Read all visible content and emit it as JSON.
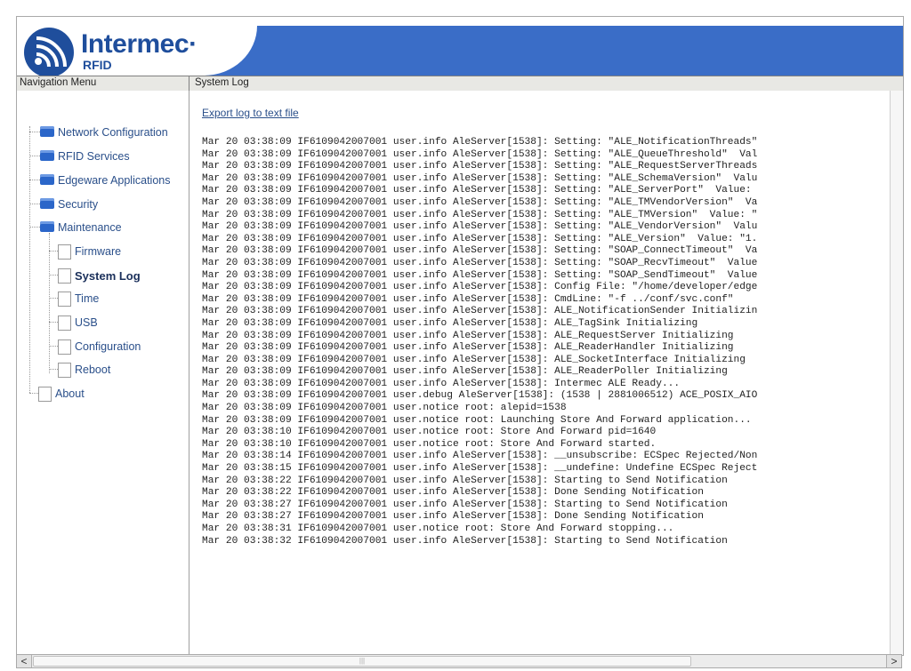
{
  "brand": {
    "name": "Intermec",
    "suffix": "RFID",
    "registered": "·"
  },
  "bars": {
    "nav_title": "Navigation Menu",
    "content_title": "System Log"
  },
  "nav": {
    "items": [
      {
        "label": "Network Configuration",
        "icon": "folder-icon"
      },
      {
        "label": "RFID Services",
        "icon": "folder-icon"
      },
      {
        "label": "Edgeware Applications",
        "icon": "folder-icon"
      },
      {
        "label": "Security",
        "icon": "folder-icon"
      },
      {
        "label": "Maintenance",
        "icon": "folder-open-icon"
      },
      {
        "label": "Firmware",
        "icon": "page-icon"
      },
      {
        "label": "System Log",
        "icon": "page-icon",
        "active": true
      },
      {
        "label": "Time",
        "icon": "page-icon"
      },
      {
        "label": "USB",
        "icon": "page-icon"
      },
      {
        "label": "Configuration",
        "icon": "page-icon"
      },
      {
        "label": "Reboot",
        "icon": "page-icon"
      },
      {
        "label": "About",
        "icon": "page-icon"
      }
    ]
  },
  "content": {
    "export_link": "Export log to text file",
    "log_lines": [
      "Mar 20 03:38:09 IF6109042007001 user.info AleServer[1538]: Setting: \"ALE_NotificationThreads\"",
      "Mar 20 03:38:09 IF6109042007001 user.info AleServer[1538]: Setting: \"ALE_QueueThreshold\"  Val",
      "Mar 20 03:38:09 IF6109042007001 user.info AleServer[1538]: Setting: \"ALE_RequestServerThreads",
      "Mar 20 03:38:09 IF6109042007001 user.info AleServer[1538]: Setting: \"ALE_SchemaVersion\"  Valu",
      "Mar 20 03:38:09 IF6109042007001 user.info AleServer[1538]: Setting: \"ALE_ServerPort\"  Value:",
      "Mar 20 03:38:09 IF6109042007001 user.info AleServer[1538]: Setting: \"ALE_TMVendorVersion\"  Va",
      "Mar 20 03:38:09 IF6109042007001 user.info AleServer[1538]: Setting: \"ALE_TMVersion\"  Value: \"",
      "Mar 20 03:38:09 IF6109042007001 user.info AleServer[1538]: Setting: \"ALE_VendorVersion\"  Valu",
      "Mar 20 03:38:09 IF6109042007001 user.info AleServer[1538]: Setting: \"ALE_Version\"  Value: \"1.",
      "Mar 20 03:38:09 IF6109042007001 user.info AleServer[1538]: Setting: \"SOAP_ConnectTimeout\"  Va",
      "Mar 20 03:38:09 IF6109042007001 user.info AleServer[1538]: Setting: \"SOAP_RecvTimeout\"  Value",
      "Mar 20 03:38:09 IF6109042007001 user.info AleServer[1538]: Setting: \"SOAP_SendTimeout\"  Value",
      "Mar 20 03:38:09 IF6109042007001 user.info AleServer[1538]: Config File: \"/home/developer/edge",
      "Mar 20 03:38:09 IF6109042007001 user.info AleServer[1538]: CmdLine: \"-f ../conf/svc.conf\"",
      "Mar 20 03:38:09 IF6109042007001 user.info AleServer[1538]: ALE_NotificationSender Initializin",
      "Mar 20 03:38:09 IF6109042007001 user.info AleServer[1538]: ALE_TagSink Initializing",
      "Mar 20 03:38:09 IF6109042007001 user.info AleServer[1538]: ALE_RequestServer Initializing",
      "Mar 20 03:38:09 IF6109042007001 user.info AleServer[1538]: ALE_ReaderHandler Initializing",
      "Mar 20 03:38:09 IF6109042007001 user.info AleServer[1538]: ALE_SocketInterface Initializing",
      "Mar 20 03:38:09 IF6109042007001 user.info AleServer[1538]: ALE_ReaderPoller Initializing",
      "Mar 20 03:38:09 IF6109042007001 user.info AleServer[1538]: Intermec ALE Ready...",
      "Mar 20 03:38:09 IF6109042007001 user.debug AleServer[1538]: (1538 | 2881006512) ACE_POSIX_AIO",
      "Mar 20 03:38:09 IF6109042007001 user.notice root: alepid=1538",
      "Mar 20 03:38:09 IF6109042007001 user.notice root: Launching Store And Forward application...",
      "Mar 20 03:38:10 IF6109042007001 user.notice root: Store And Forward pid=1640",
      "Mar 20 03:38:10 IF6109042007001 user.notice root: Store And Forward started.",
      "Mar 20 03:38:14 IF6109042007001 user.info AleServer[1538]: __unsubscribe: ECSpec Rejected/Non",
      "Mar 20 03:38:15 IF6109042007001 user.info AleServer[1538]: __undefine: Undefine ECSpec Reject",
      "Mar 20 03:38:22 IF6109042007001 user.info AleServer[1538]: Starting to Send Notification",
      "Mar 20 03:38:22 IF6109042007001 user.info AleServer[1538]: Done Sending Notification",
      "Mar 20 03:38:27 IF6109042007001 user.info AleServer[1538]: Starting to Send Notification",
      "Mar 20 03:38:27 IF6109042007001 user.info AleServer[1538]: Done Sending Notification",
      "Mar 20 03:38:31 IF6109042007001 user.notice root: Store And Forward stopping...",
      "Mar 20 03:38:32 IF6109042007001 user.info AleServer[1538]: Starting to Send Notification"
    ]
  },
  "scrollbar": {
    "left_arrow": "<",
    "right_arrow": ">",
    "grip": "|||"
  }
}
